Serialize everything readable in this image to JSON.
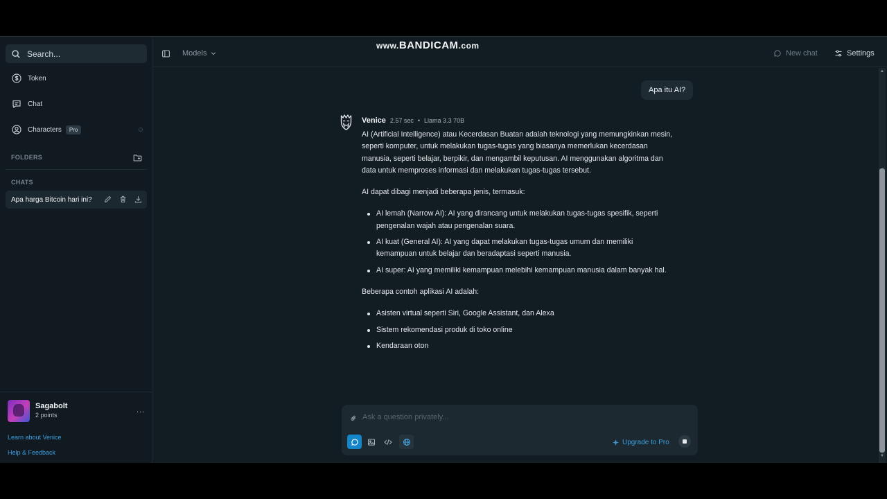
{
  "watermark": {
    "prefix": "www.",
    "brand": "BANDICAM",
    "suffix": ".com"
  },
  "sidebar": {
    "search_label": "Search...",
    "nav": [
      {
        "label": "Token",
        "icon": "dollar-circle-icon"
      },
      {
        "label": "Chat",
        "icon": "chat-icon"
      },
      {
        "label": "Characters",
        "icon": "user-circle-icon",
        "badge": "Pro"
      }
    ],
    "folders_heading": "FOLDERS",
    "chats_heading": "CHATS",
    "chats": [
      {
        "title": "Apa harga Bitcoin hari ini?"
      }
    ],
    "user": {
      "name": "Sagabolt",
      "points": "2 points",
      "menu": "..."
    },
    "links": {
      "learn": "Learn about Venice",
      "help": "Help & Feedback"
    }
  },
  "header": {
    "models_label": "Models",
    "new_chat_label": "New chat",
    "settings_label": "Settings"
  },
  "conversation": {
    "user_message": "Apa itu AI?",
    "assistant": {
      "name": "Venice",
      "time": "2.57 sec",
      "separator": "•",
      "model": "Llama 3.3 70B",
      "p1": "AI (Artificial Intelligence) atau Kecerdasan Buatan adalah teknologi yang memungkinkan mesin, seperti komputer, untuk melakukan tugas-tugas yang biasanya memerlukan kecerdasan manusia, seperti belajar, berpikir, dan mengambil keputusan. AI menggunakan algoritma dan data untuk memproses informasi dan melakukan tugas-tugas tersebut.",
      "p2": "AI dapat dibagi menjadi beberapa jenis, termasuk:",
      "list1": [
        "AI lemah (Narrow AI): AI yang dirancang untuk melakukan tugas-tugas spesifik, seperti pengenalan wajah atau pengenalan suara.",
        "AI kuat (General AI): AI yang dapat melakukan tugas-tugas umum dan memiliki kemampuan untuk belajar dan beradaptasi seperti manusia.",
        "AI super: AI yang memiliki kemampuan melebihi kemampuan manusia dalam banyak hal."
      ],
      "p3": "Beberapa contoh aplikasi AI adalah:",
      "list2": [
        "Asisten virtual seperti Siri, Google Assistant, dan Alexa",
        "Sistem rekomendasi produk di toko online",
        "Kendaraan oton"
      ]
    }
  },
  "composer": {
    "placeholder": "Ask a question privately...",
    "upgrade_label": "Upgrade to Pro"
  },
  "colors": {
    "accent": "#1585c9",
    "link": "#3d9fe0",
    "background": "#121d23",
    "sidebar": "#101a20"
  }
}
